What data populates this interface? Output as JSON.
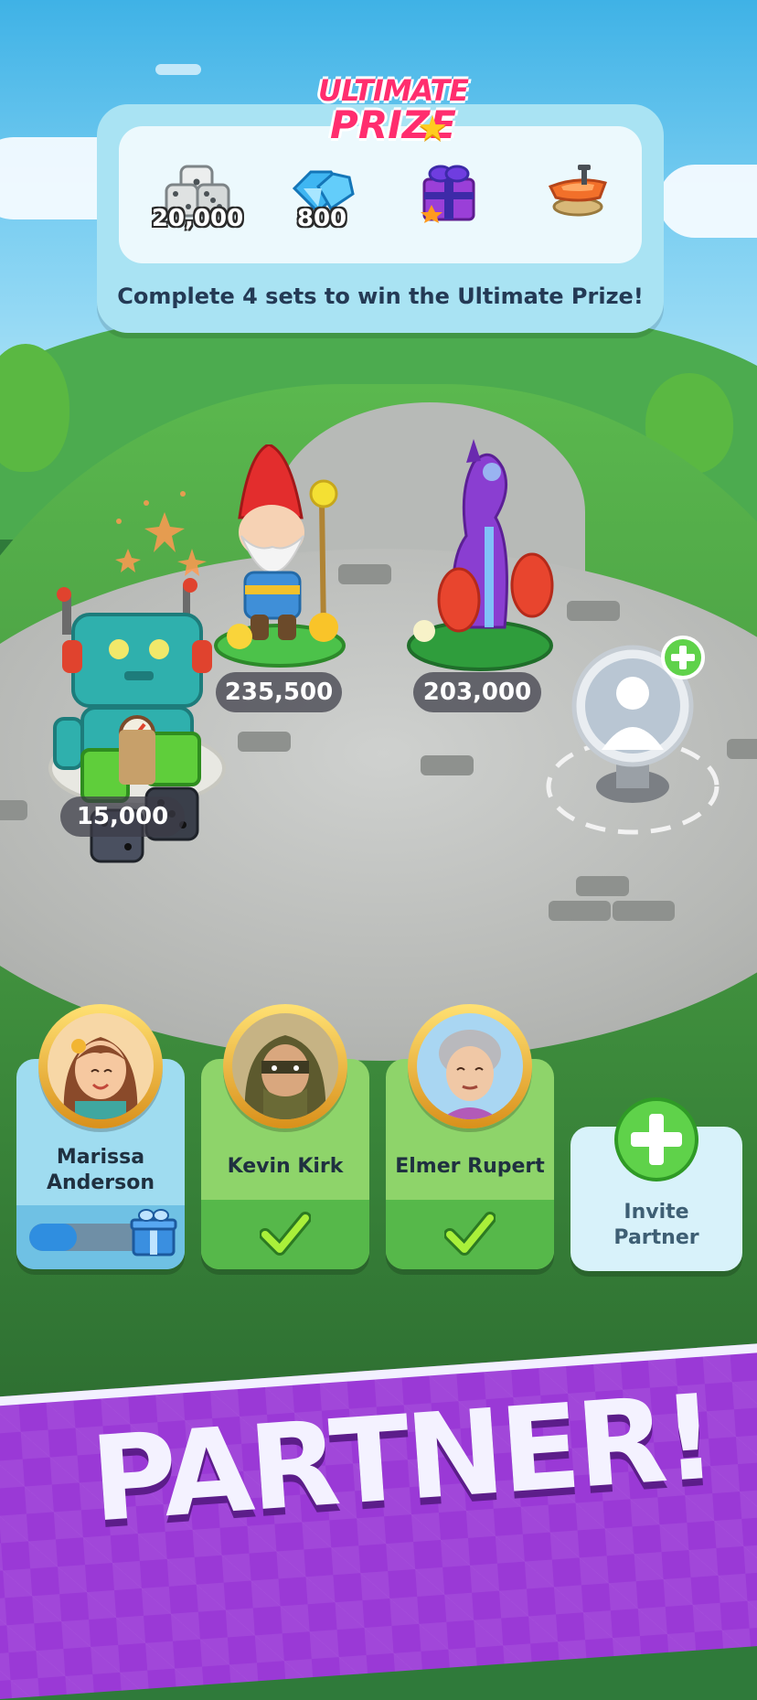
{
  "prize": {
    "title_line1": "ULTIMATE",
    "title_line2": "PRIZE",
    "rewards": [
      {
        "icon": "dice-icon",
        "quantity": "20,000"
      },
      {
        "icon": "gems-icon",
        "quantity": "800"
      },
      {
        "icon": "gift-box-icon",
        "quantity": ""
      },
      {
        "icon": "boat-token-icon",
        "quantity": ""
      }
    ],
    "caption": "Complete 4 sets to win the Ultimate Prize!"
  },
  "figures": [
    {
      "name": "robot-figure",
      "score": "15,000"
    },
    {
      "name": "gnome-figure",
      "score": "235,500"
    },
    {
      "name": "dinosaur-fountain-figure",
      "score": "203,000"
    }
  ],
  "partners": [
    {
      "name_line1": "Marissa",
      "name_line2": "Anderson",
      "progress": 0.4,
      "status": "in-progress"
    },
    {
      "name": "Kevin Kirk",
      "status": "complete"
    },
    {
      "name": "Elmer Rupert",
      "status": "complete"
    }
  ],
  "invite": {
    "line1": "Invite",
    "line2": "Partner"
  },
  "banner": {
    "text": "PARTNER!"
  },
  "colors": {
    "accent_green": "#56b84a",
    "banner_purple": "#9a39d6",
    "panel_blue": "#a9e3f3",
    "prize_pink": "#ff2d6e"
  }
}
